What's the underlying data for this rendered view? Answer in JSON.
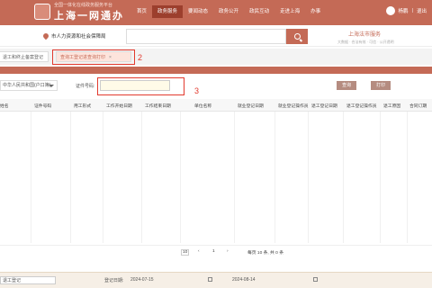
{
  "header": {
    "logo_sub": "全国一体化在线政务服务平台",
    "logo_title": "上海一网通办",
    "nav": [
      "首页",
      "政务服务",
      "要闻动态",
      "政务公开",
      "政民互动",
      "走进上海",
      "办事"
    ],
    "user_name": "杨鹏",
    "logout": "退出"
  },
  "search": {
    "location": "市人力资源和社会保障局",
    "placeholder": ""
  },
  "brand": {
    "title": "上海法市服务",
    "subtitle": "大数据 · 合法有效 · 可信 · 公开透明"
  },
  "tabs": [
    {
      "label": "退工和终止备案登记"
    },
    {
      "label": "查询工登记进查询打印"
    }
  ],
  "annotations": [
    "2",
    "3"
  ],
  "filters": {
    "type_select": "中华人民共和国(户口簿)",
    "cert_label": "证件号码:",
    "cert_value": "",
    "query_button": "查询",
    "print_button": "打印"
  },
  "table": {
    "columns": [
      "姓名",
      "证件号码",
      "用工形式",
      "工作开始日期",
      "工作结束日期",
      "单位名称",
      "就业登记日期",
      "就业登记操作员",
      "退工登记日期",
      "退工登记操作员",
      "退工原因",
      "合同订期"
    ]
  },
  "pager": {
    "page_size": "10",
    "current": "1",
    "summary": "每页 10 条, 共 0 条"
  },
  "bottom": {
    "select": "退工登记",
    "date_label": "登记日期:",
    "date_from": "2024-07-15",
    "date_to": "2024-08-14"
  }
}
